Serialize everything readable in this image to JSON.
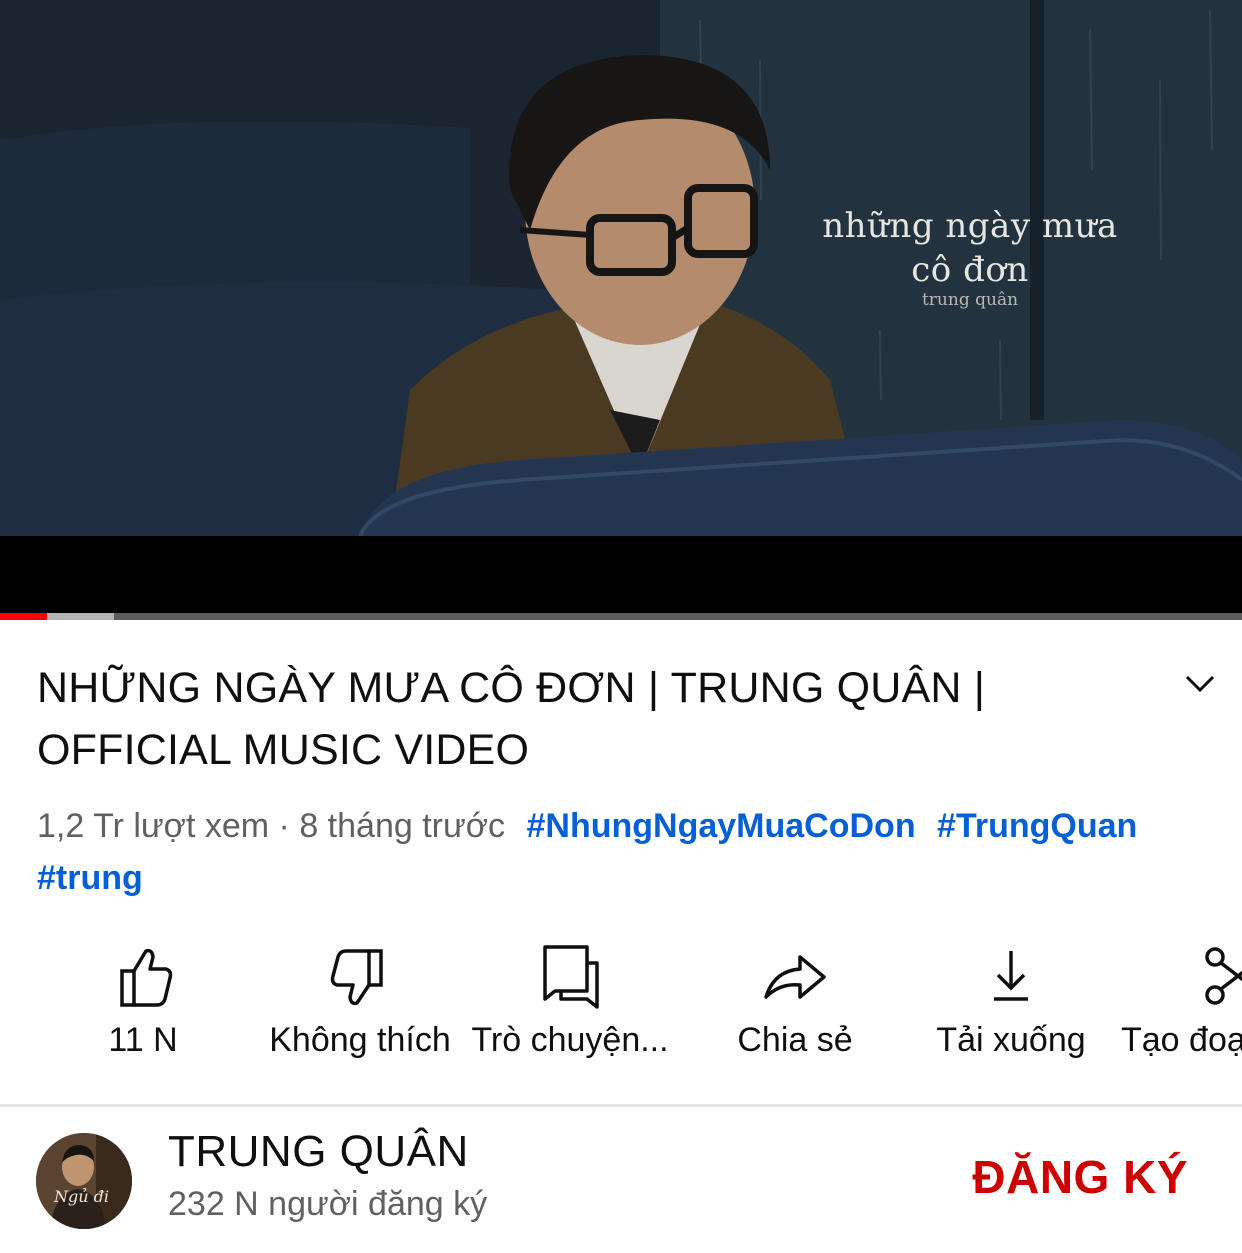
{
  "player": {
    "overlay_title_line1": "những ngày mưa",
    "overlay_title_line2": "cô đơn",
    "overlay_artist": "trung quân",
    "progress_played_fraction": 0.038,
    "progress_buffered_fraction": 0.092
  },
  "video": {
    "title": "NHỮNG NGÀY MƯA CÔ ĐƠN | TRUNG QUÂN | OFFICIAL MUSIC VIDEO",
    "views": "1,2 Tr lượt xem",
    "separator": " · ",
    "published": "8 tháng trước",
    "hashtags": [
      "#NhungNgayMuaCoDon",
      "#TrungQuan",
      "#trung"
    ]
  },
  "actions": [
    {
      "name": "like",
      "label": "11 N",
      "icon": "thumbs-up-icon"
    },
    {
      "name": "dislike",
      "label": "Không thích",
      "icon": "thumbs-down-icon"
    },
    {
      "name": "live-chat",
      "label": "Trò chuyện...",
      "icon": "chat-icon"
    },
    {
      "name": "share",
      "label": "Chia sẻ",
      "icon": "share-icon"
    },
    {
      "name": "download",
      "label": "Tải xuống",
      "icon": "download-icon"
    },
    {
      "name": "clip",
      "label": "Tạo đoạ",
      "icon": "scissors-icon"
    }
  ],
  "channel": {
    "name": "TRUNG QUÂN",
    "subscribers": "232 N người đăng ký",
    "avatar_text": "Ngủ đi",
    "subscribe_label": "ĐĂNG KÝ"
  },
  "colors": {
    "progress_played": "#ff0000",
    "hashtag": "#065fd4",
    "subscribe": "#cc0000",
    "secondary_text": "#606060"
  }
}
